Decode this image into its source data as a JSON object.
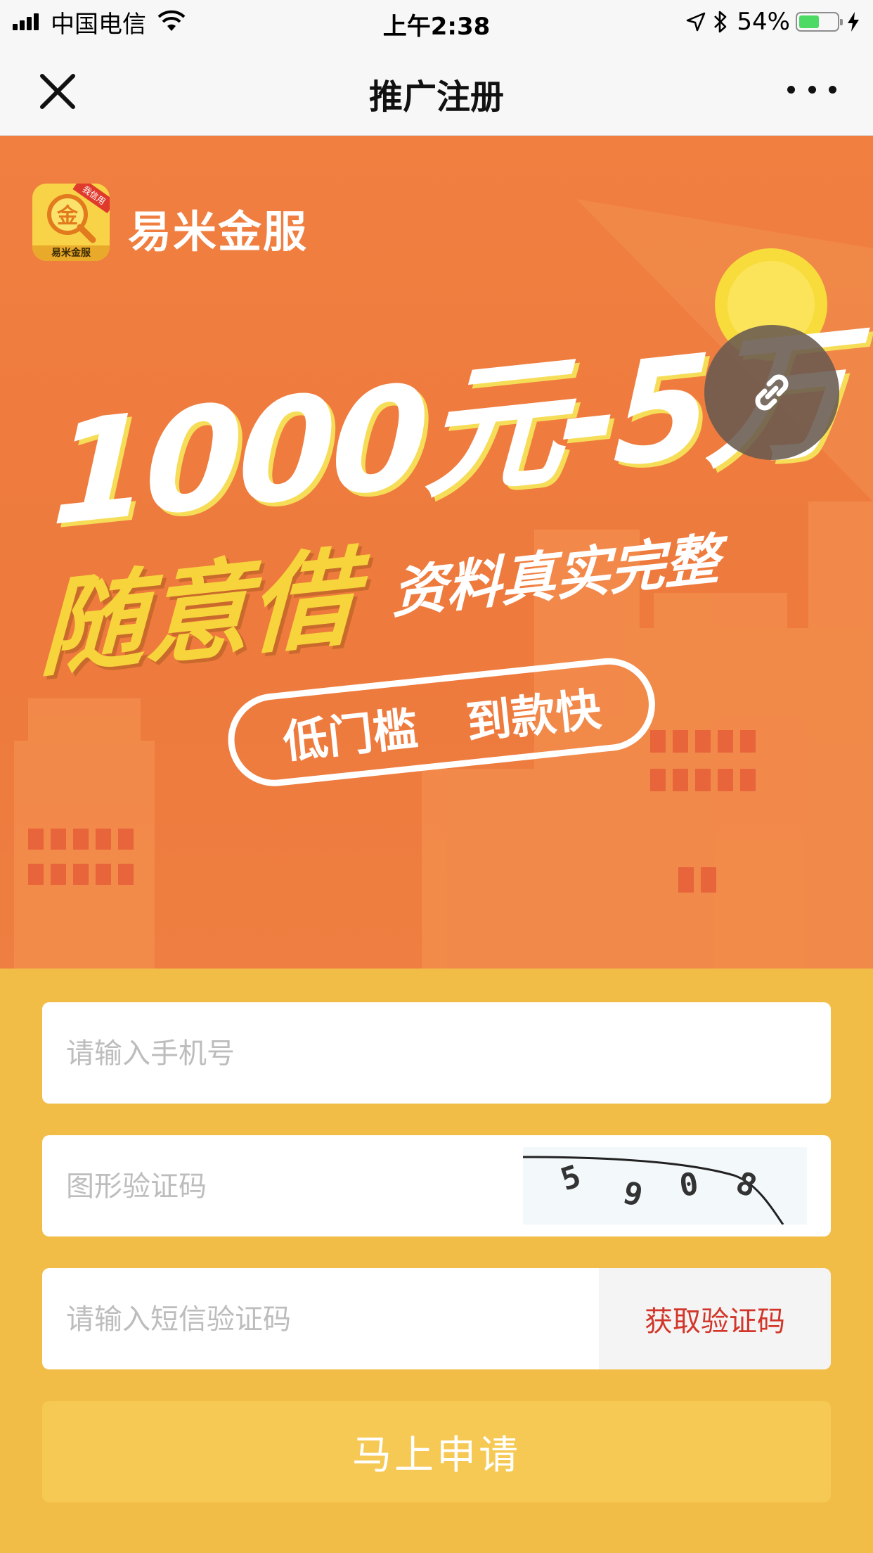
{
  "status_bar": {
    "carrier": "中国电信",
    "time": "上午2:38",
    "battery_percent": "54%",
    "battery_level": 0.54,
    "icons": [
      "signal-icon",
      "wifi-icon",
      "location-arrow-icon",
      "bluetooth-icon",
      "battery-icon",
      "charging-bolt-icon"
    ]
  },
  "nav": {
    "title": "推广注册",
    "close_icon": "close-icon",
    "more_icon": "more-icon"
  },
  "banner": {
    "app_name": "易米金服",
    "logo_badge": "我信用",
    "logo_sub": "易米金服",
    "logo_glyph": "金",
    "headline_amount": "1000元-5万",
    "headline_borrow": "随意借",
    "headline_tagline": "资料真实完整",
    "pill_left": "低门槛",
    "pill_right": "到款快",
    "share_icon": "link-icon",
    "colors": {
      "orange": "#EE7A3D",
      "yellow": "#F7D43C",
      "coin": "#F8DC3C"
    }
  },
  "form": {
    "phone_placeholder": "请输入手机号",
    "captcha_placeholder": "图形验证码",
    "captcha_text": "5908",
    "sms_placeholder": "请输入短信验证码",
    "sms_button": "获取验证码",
    "submit_button": "马上申请",
    "colors": {
      "background": "#F2BD47",
      "submit": "#F6C954",
      "sms_text": "#D2362A"
    }
  }
}
